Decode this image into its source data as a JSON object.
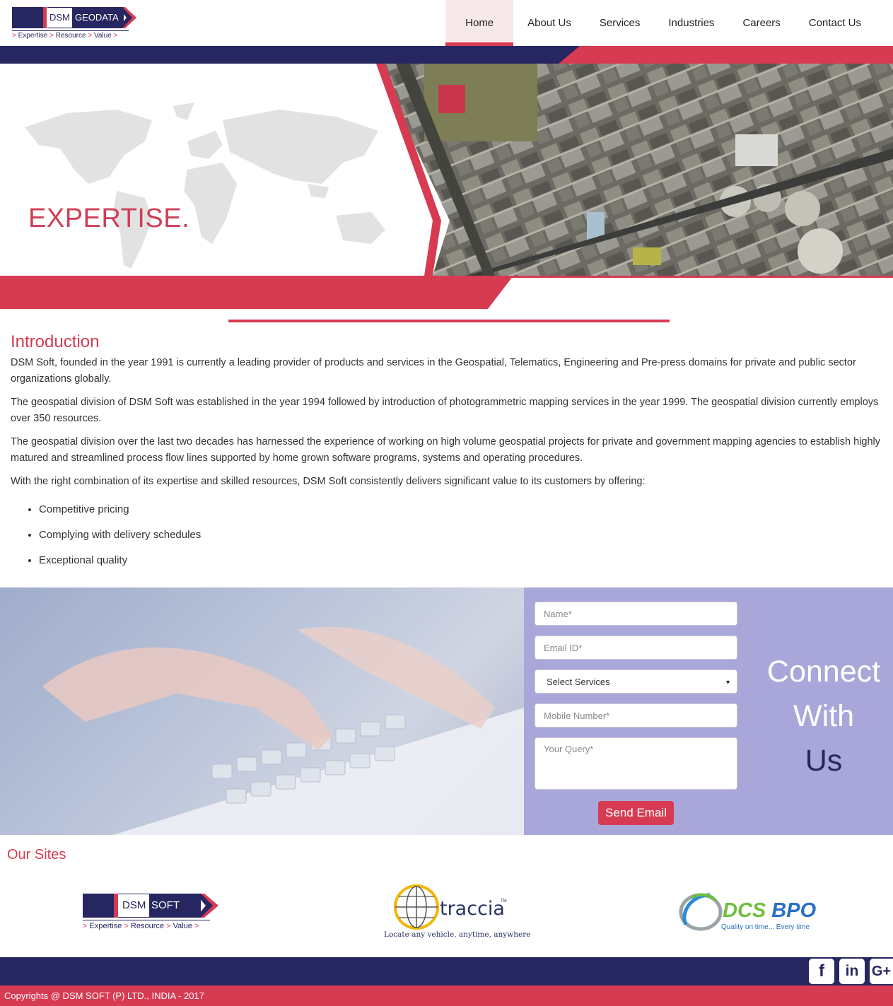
{
  "brand": {
    "logo_left": "DSM",
    "logo_right": "GEODATA",
    "tag_1": "Expertise",
    "tag_2": "Resource",
    "tag_3": "Value"
  },
  "nav": {
    "items": [
      "Home",
      "About Us",
      "Services",
      "Industries",
      "Careers",
      "Contact Us"
    ],
    "active": "Home"
  },
  "hero": {
    "headline": "EXPERTISE."
  },
  "intro": {
    "title": "Introduction",
    "paragraphs": [
      "DSM Soft, founded in the year 1991 is currently a leading provider of products and services in the Geospatial, Telematics, Engineering and Pre-press domains for private and public sector organizations globally.",
      "The geospatial division of DSM Soft was established in the year 1994 followed by introduction of photogrammetric mapping services in the year 1999. The geospatial division currently employs over 350 resources.",
      "The geospatial division over the last two decades has harnessed the experience of working on high volume geospatial projects for private and government mapping agencies to establish highly matured and streamlined process flow lines supported by home grown software programs, systems and operating procedures.",
      "With the right combination of its expertise and skilled resources, DSM Soft consistently delivers significant value to its customers by offering:"
    ],
    "bullets": [
      "Competitive pricing",
      "Complying with delivery schedules",
      "Exceptional quality"
    ]
  },
  "contact": {
    "name_placeholder": "Name*",
    "email_placeholder": "Email ID*",
    "service_selected": "Select Services",
    "mobile_placeholder": "Mobile Number*",
    "query_placeholder": "Your Query*",
    "send_label": "Send Email",
    "heading_1": "Connect",
    "heading_2": "With",
    "heading_3": "Us"
  },
  "sites": {
    "title": "Our Sites",
    "dsmsoft_left": "DSM",
    "dsmsoft_right": "SOFT",
    "dsmsoft_tag_1": "Expertise",
    "dsmsoft_tag_2": "Resource",
    "dsmsoft_tag_3": "Value",
    "traccia_name": "traccia",
    "traccia_tm": "TM",
    "traccia_tagline": "Locate any vehicle, anytime, anywhere",
    "dcs_name_1": "DCS",
    "dcs_name_2": "BPO",
    "dcs_tagline": "Quality on time... Every time"
  },
  "social": {
    "facebook": "f",
    "linkedin": "in",
    "google": "G+"
  },
  "footer": {
    "copyright": "Copyrights @ DSM SOFT (P) LTD., INDIA - 2017"
  },
  "colors": {
    "brand_navy": "#262660",
    "brand_red": "#d63b52",
    "contact_bg": "#a9a7da"
  }
}
